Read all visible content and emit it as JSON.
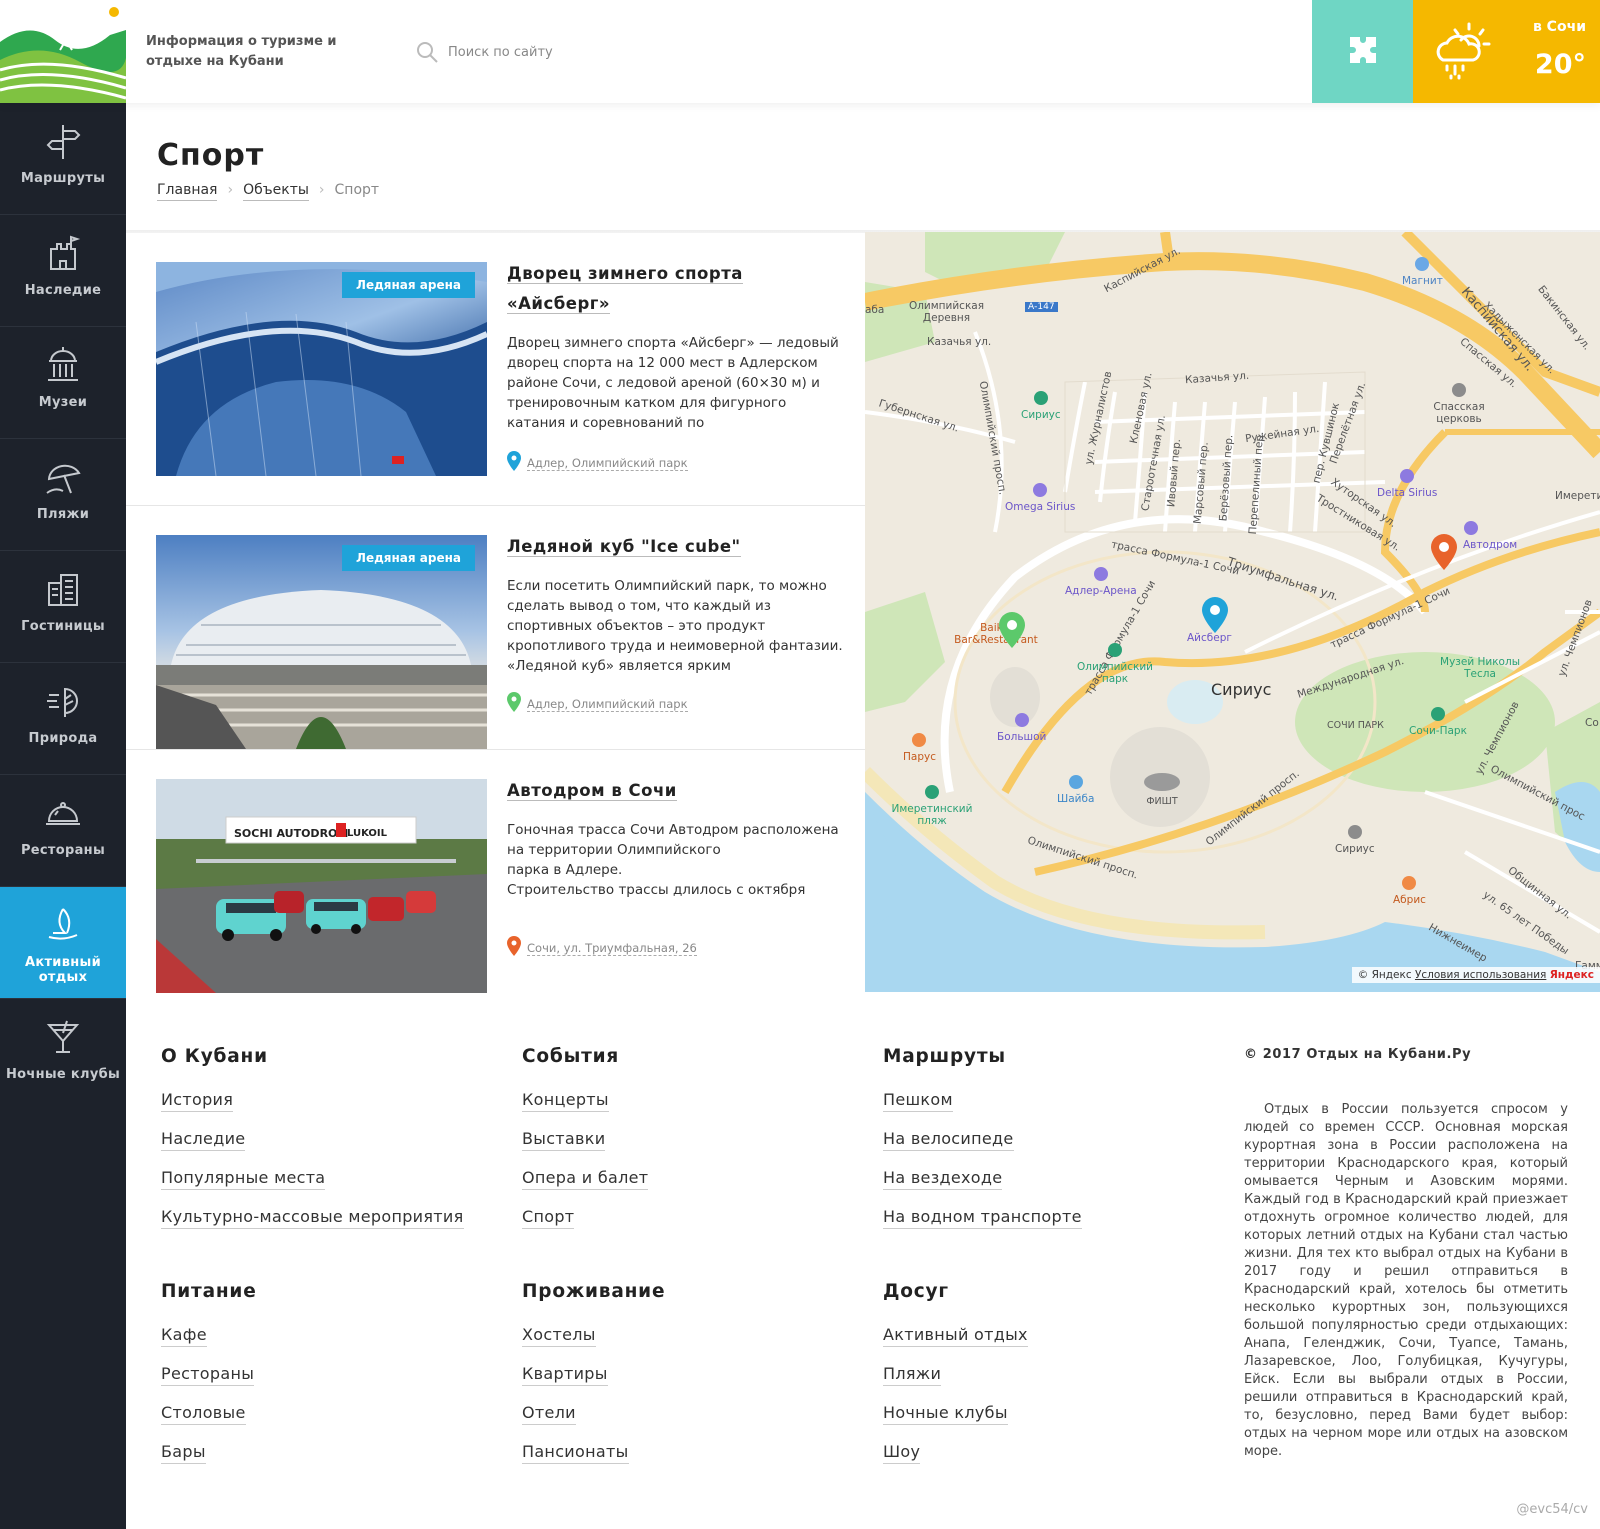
{
  "header": {
    "site_description": "Информация о туризме и отдыхе на Кубани",
    "search": {
      "placeholder": "Поиск по сайту"
    },
    "weather": {
      "city": "в Сочи",
      "temperature": "20°",
      "icon": "cloud-sun-rain-icon"
    },
    "puzzle_icon": "puzzle-icon",
    "colors": {
      "puzzle_bg": "#6fd6c4",
      "weather_bg": "#f5b800"
    }
  },
  "sidebar": {
    "items": [
      {
        "label": "Маршруты",
        "icon": "signpost-icon"
      },
      {
        "label": "Наследие",
        "icon": "castle-icon"
      },
      {
        "label": "Музеи",
        "icon": "museum-icon"
      },
      {
        "label": "Пляжи",
        "icon": "beach-umbrella-icon"
      },
      {
        "label": "Гостиницы",
        "icon": "hotel-icon"
      },
      {
        "label": "Природа",
        "icon": "nature-icon"
      },
      {
        "label": "Рестораны",
        "icon": "cloche-icon"
      },
      {
        "label": "Активный отдых",
        "icon": "sailboat-icon",
        "active": true
      },
      {
        "label": "Ночные клубы",
        "icon": "cocktail-icon"
      }
    ],
    "colors": {
      "bg": "#1d222b",
      "active": "#1fa3d9"
    }
  },
  "page": {
    "title": "Спорт",
    "breadcrumb": [
      {
        "label": "Главная"
      },
      {
        "label": "Объекты"
      },
      {
        "label": "Спорт"
      }
    ]
  },
  "listings": [
    {
      "title": "Дворец зимнего спорта «Айсберг»",
      "badge": "Ледяная арена",
      "description": "Дворец зимнего спорта «Айсберг» — ледовый дворец спорта на 12 000 мест в Адлерском районе Сочи, с ледовой ареной (60×30 м) и тренировочным катком для фигурного катания и соревнований по",
      "location": "Адлер, Олимпийский парк",
      "pin_color": "#1fa3d9"
    },
    {
      "title": "Ледяной куб \"Ice cube\"",
      "badge": "Ледяная арена",
      "description": "Если посетить Олимпийский парк, то можно сделать вывод о том, что каждый из спортивных объектов – это продукт кропотливого труда и неимоверной фантазии. «Ледяной куб» является ярким",
      "location": "Адлер, Олимпийский парк",
      "pin_color": "#5cc96b"
    },
    {
      "title": "Автодром в Сочи",
      "badge": "",
      "description": "Гоночная трасса Сочи Автодром расположена\nна территории Олимпийского\nпарка в Адлере.\nСтроительство трассы длилось с октября",
      "location": "Сочи, ул. Триумфальная, 26",
      "pin_color": "#e8632b",
      "image_text": {
        "autodrom": "SOCHI AUTODROM",
        "sponsor": "LUKOIL"
      }
    }
  ],
  "map": {
    "labels": {
      "kaspiyskaya1": "Каспийская ул.",
      "kaspiyskaya2": "Каспийская ул.",
      "magnit": "Магнит",
      "bakinskaya": "Бакинская ул.",
      "khadyzhenskaya": "Хадыженская ул.",
      "spasskaya": "Спасская ул.",
      "olymp_village": "Олимпийская Деревня",
      "a147": "А-147",
      "kazachya1": "Казачья ул.",
      "kazachya2": "Казачья ул.",
      "sirius_top": "Сириус",
      "gubernskaya": "Губернская ул.",
      "olymp_prosp_left": "Олимпийский просп.",
      "zhurnalistov": "ул. Журналистов",
      "klenovaya": "Кленовая ул.",
      "starootechnaya": "Староотечная ул.",
      "ivovy": "Ивовый пер.",
      "marsovy": "Марсовый пер.",
      "berezovy": "Берёзовый пер.",
      "perepelinny": "Перепелиный пер.",
      "ruzheynaya": "Ружейная ул.",
      "kuvshinok": "пер. Кувшинок",
      "pereletnaya": "Перелётная ул.",
      "spasskaya_church": "Спасская церковь",
      "omega": "Omega Sirius",
      "delta": "Delta Sirius",
      "imereti_kurort": "Имерети Курор",
      "khutorskaya": "Хуторская ул.",
      "trostnikovaya": "Тростниковая ул.",
      "avtodrom": "Автодром",
      "formula1": "трасса Формула-1 Сочи",
      "triumfalnaya": "Триумфальная ул.",
      "formula2": "трасса Формула-1 Сочи",
      "formula3": "трасса Формула-1 Сочи",
      "adler_arena": "Адлер-Арена",
      "baikal": "Baikal Bar&Restaurant",
      "aysberg": "Айсберг",
      "olymp_park": "Олимпийский парк",
      "sirius_big": "Сириус",
      "mezhdunarodnaya": "Международная ул.",
      "tesla": "Музей Николы Тесла",
      "sochi_park": "СОЧИ ПАРК",
      "sochi_park2": "Сочи-Парк",
      "chempionov": "ул. Чемпионов",
      "chempionov2": "ул. Чемпионов",
      "bolshoy": "Большой",
      "parus": "Парус",
      "imereti_beach": "Имеретинский пляж",
      "shayba": "Шайба",
      "fisht": "ФИШТ",
      "olymp_prosp_mid": "Олимпийский просп.",
      "olymp_prosp_bot": "Олимпийский просп.",
      "olymp_prosp_right": "Олимпийский прос",
      "sirius_small": "Сириус",
      "abris": "Абрис",
      "obshchinnaya": "Общинная ул.",
      "pobedy": "ул. 65 лет Победы",
      "nizhneimer": "Нижнеимер",
      "co": "Со",
      "gamm": "Гамм",
      "aba": "аба"
    },
    "copyright": "© Яндекс",
    "terms": "Условия использования",
    "brand": "Яндекс"
  },
  "footer": {
    "columns": [
      {
        "title": "О Кубани",
        "links": [
          "История",
          "Наследие",
          "Популярные места",
          "Культурно-массовые мероприятия"
        ]
      },
      {
        "title": "События",
        "links": [
          "Концерты",
          "Выставки",
          "Опера и балет",
          "Спорт"
        ]
      },
      {
        "title": "Маршруты",
        "links": [
          "Пешком",
          "На велосипеде",
          "На вездеходе",
          "На водном транспорте"
        ]
      },
      {
        "title": "Питание",
        "links": [
          "Кафе",
          "Рестораны",
          "Столовые",
          "Бары"
        ]
      },
      {
        "title": "Проживание",
        "links": [
          "Хостелы",
          "Квартиры",
          "Отели",
          "Пансионаты"
        ]
      },
      {
        "title": "Досуг",
        "links": [
          "Активный отдых",
          "Пляжи",
          "Ночные клубы",
          "Шоу"
        ]
      }
    ],
    "copyright": "© 2017 Отдых на Кубани.Ру",
    "about": "Отдых в России пользуется спросом у людей со времен СССР. Основная морская курортная зона в России расположена на территории Краснодарского края, который омывается Черным и Азовским морями. Каждый год в Краснодарский край приезжает отдохнуть огромное количество людей, для которых летний отдых на Кубани стал частью жизни. Для тех кто выбрал отдых на Кубани в 2017 году и решил отправиться в Краснодарский край, хотелось бы отметить несколько курортных зон, пользующихся большой популярностью среди отдыхающих: Анапа, Геленджик, Сочи, Туапсе, Тамань, Лазаревское, Лоо, Голубицкая, Кучугуры, Ейск. Если вы выбрали отдых в России, решили отправиться в Краснодарский край, то, безусловно, перед Вами будет выбор: отдых на черном море или отдых на азовском море.",
    "watermark": "@evc54/cv"
  }
}
